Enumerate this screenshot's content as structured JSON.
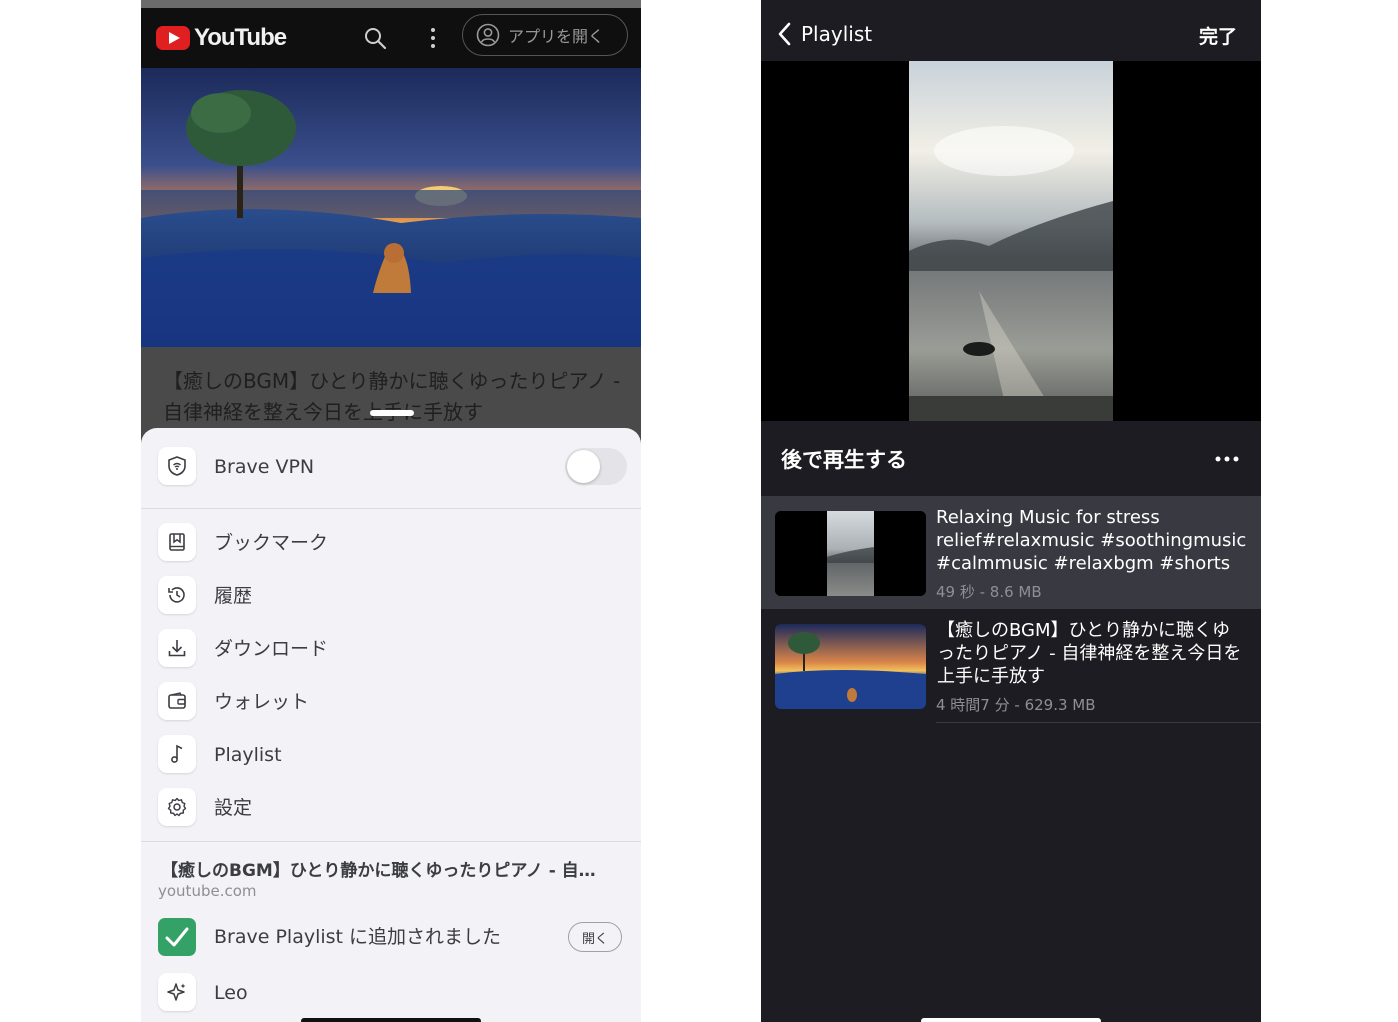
{
  "left": {
    "header": {
      "logo_text": "YouTube",
      "open_app_label": "アプリを開く",
      "icons": [
        "youtube-logo-icon",
        "search-icon",
        "more-vertical-icon",
        "account-icon"
      ]
    },
    "video": {
      "title": "【癒しのBGM】ひとり静かに聴くゆったりピアノ - 自律神経を整え今日を上手に手放す"
    },
    "menu": {
      "vpn_label": "Brave VPN",
      "vpn_enabled": false,
      "items": [
        {
          "label": "ブックマーク",
          "icon": "bookmark-icon"
        },
        {
          "label": "履歴",
          "icon": "history-icon"
        },
        {
          "label": "ダウンロード",
          "icon": "download-icon"
        },
        {
          "label": "ウォレット",
          "icon": "wallet-icon"
        },
        {
          "label": "Playlist",
          "icon": "music-note-icon"
        },
        {
          "label": "設定",
          "icon": "gear-icon"
        }
      ],
      "added": {
        "title": "【癒しのBGM】ひとり静かに聴くゆったりピアノ - 自…",
        "domain": "youtube.com",
        "message": "Brave Playlist に追加されました",
        "open_label": "開く"
      },
      "leo_label": "Leo"
    }
  },
  "right": {
    "nav": {
      "back_label": "Playlist",
      "done_label": "完了"
    },
    "list": {
      "header": "後で再生する",
      "items": [
        {
          "title": "Relaxing Music for stress relief#relaxmusic #soothingmusic #calmmusic #relaxbgm #shorts",
          "meta": "49 秒 - 8.6 MB",
          "active": true
        },
        {
          "title": "【癒しのBGM】ひとり静かに聴くゆったりピアノ - 自律神経を整え今日を上手に手放す",
          "meta": "4 時間7 分 - 629.3 MB",
          "active": false
        }
      ]
    }
  },
  "colors": {
    "youtube_red": "#e02020",
    "check_green": "#34a266",
    "dark_bg": "#1c1c22",
    "sheet_bg": "#f2f2f7"
  }
}
